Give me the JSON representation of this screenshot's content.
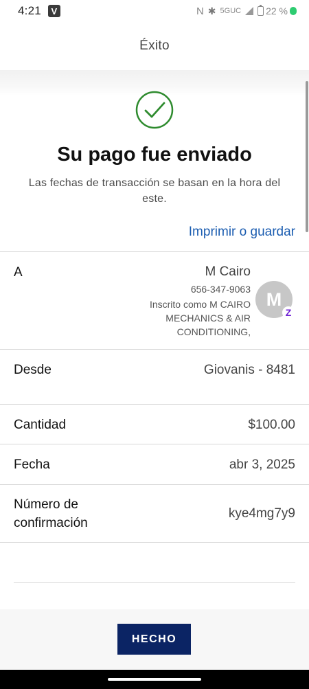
{
  "status_bar": {
    "time": "4:21",
    "app_badge": "V",
    "nfc_icon": "N",
    "bluetooth_icon": "✱",
    "network": "5GUC",
    "battery_percent": "22 %"
  },
  "header": {
    "title": "Éxito"
  },
  "success": {
    "icon": "check-circle-icon",
    "title": "Su pago fue enviado",
    "subtitle": "Las fechas de transacción se basan en la hora del este.",
    "print_link": "Imprimir o guardar"
  },
  "details": {
    "to": {
      "label": "A",
      "name": "M Cairo",
      "phone": "656-347-9063",
      "enrolled": "Inscrito como M CAIRO MECHANICS & AIR CONDITIONING,",
      "avatar_initial": "M",
      "badge": "Z"
    },
    "from": {
      "label": "Desde",
      "value": "Giovanis - 8481"
    },
    "amount": {
      "label": "Cantidad",
      "value": "$100.00"
    },
    "date": {
      "label": "Fecha",
      "value": "abr 3, 2025"
    },
    "confirmation": {
      "label_line1": "Número de",
      "label_line2": "confirmación",
      "value": "kye4mg7y9"
    }
  },
  "footer": {
    "done_label": "HECHO"
  },
  "colors": {
    "accent_link": "#1a5cb0",
    "success_green": "#2e8b2e",
    "button_navy": "#0b2464",
    "zelle_purple": "#6d1ed4"
  }
}
